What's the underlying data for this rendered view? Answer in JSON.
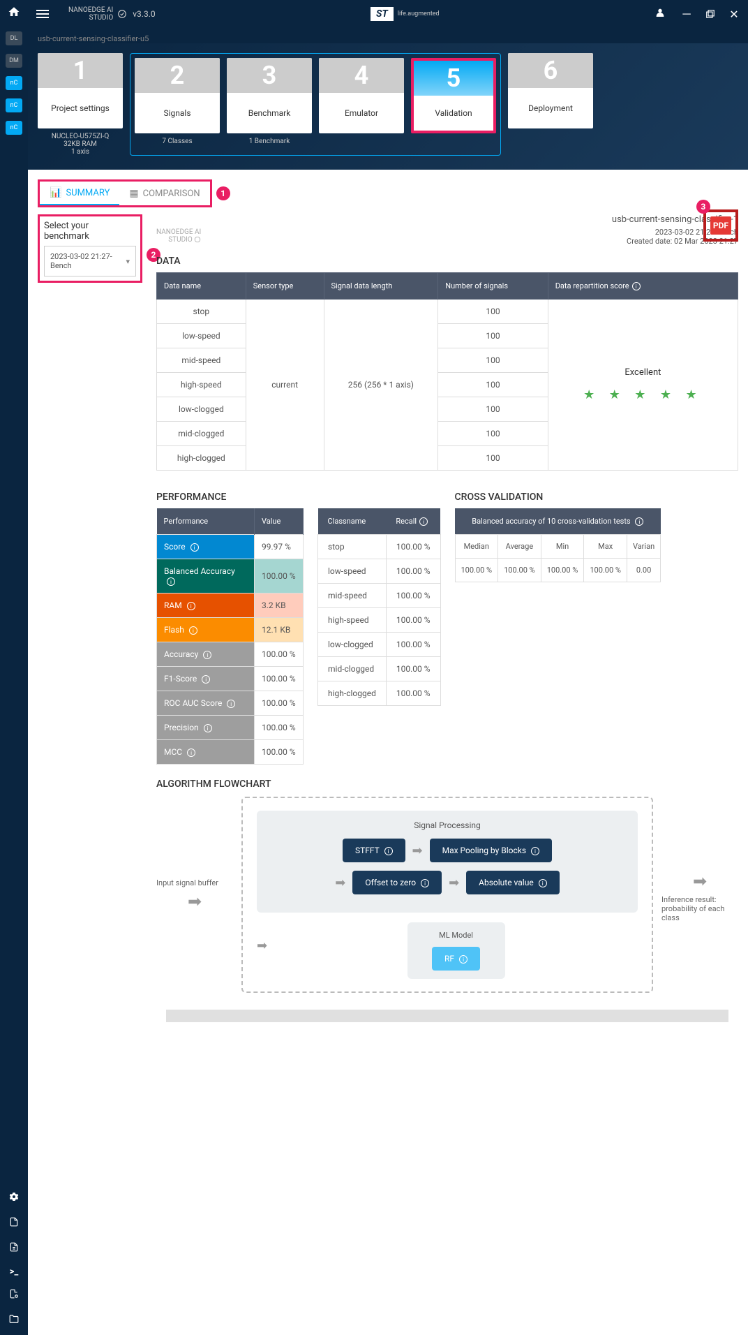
{
  "app": {
    "title_line1": "NANOEDGE AI",
    "title_line2": "STUDIO",
    "version": "v3.3.0",
    "tagline": "life.augmented",
    "st": "ST"
  },
  "sidebar": {
    "items": [
      "DL",
      "DM",
      "nC",
      "nC",
      "nC"
    ],
    "active_index": 2
  },
  "breadcrumb": "usb-current-sensing-classifier-u5",
  "steps": [
    {
      "num": "1",
      "label": "Project settings",
      "info": "NUCLEO-U575ZI-Q\n32KB RAM\n1 axis"
    },
    {
      "num": "2",
      "label": "Signals",
      "info": "7 Classes"
    },
    {
      "num": "3",
      "label": "Benchmark",
      "info": "1 Benchmark"
    },
    {
      "num": "4",
      "label": "Emulator",
      "info": ""
    },
    {
      "num": "5",
      "label": "Validation",
      "info": ""
    },
    {
      "num": "6",
      "label": "Deployment",
      "info": ""
    }
  ],
  "tabs": {
    "summary": "SUMMARY",
    "comparison": "COMPARISON"
  },
  "markers": {
    "m1": "1",
    "m2": "2",
    "m3": "3"
  },
  "benchmark_select": {
    "label": "Select your benchmark",
    "value": "2023-03-02 21:27-Bench"
  },
  "small_logo": {
    "l1": "NANOEDGE AI",
    "l2": "STUDIO"
  },
  "meta": {
    "title": "usb-current-sensing-classifier-1",
    "bench": "2023-03-02 21:27-Bench",
    "created": "Created date: 02 Mar 2023 21:27"
  },
  "pdf_label": "PDF",
  "sections": {
    "data": "DATA",
    "perf": "PERFORMANCE",
    "cross": "CROSS VALIDATION",
    "flow": "ALGORITHM FLOWCHART"
  },
  "data_table": {
    "headers": [
      "Data name",
      "Sensor type",
      "Signal data length",
      "Number of signals",
      "Data repartition score"
    ],
    "names": [
      "stop",
      "low-speed",
      "mid-speed",
      "high-speed",
      "low-clogged",
      "mid-clogged",
      "high-clogged"
    ],
    "sensor": "current",
    "length": "256 (256 * 1 axis)",
    "signals": [
      "100",
      "100",
      "100",
      "100",
      "100",
      "100",
      "100"
    ],
    "rating_label": "Excellent",
    "stars": "★ ★ ★ ★ ★"
  },
  "perf_table": {
    "h1": "Performance",
    "h2": "Value",
    "rows": [
      {
        "label": "Score",
        "value": "99.97 %",
        "cls": "score",
        "vcls": ""
      },
      {
        "label": "Balanced Accuracy",
        "value": "100.00 %",
        "cls": "balacc",
        "vcls": "balacc"
      },
      {
        "label": "RAM",
        "value": "3.2 KB",
        "cls": "ram",
        "vcls": "ram"
      },
      {
        "label": "Flash",
        "value": "12.1 KB",
        "cls": "flash",
        "vcls": "flash"
      },
      {
        "label": "Accuracy",
        "value": "100.00 %",
        "cls": "gray",
        "vcls": ""
      },
      {
        "label": "F1-Score",
        "value": "100.00 %",
        "cls": "gray",
        "vcls": ""
      },
      {
        "label": "ROC AUC Score",
        "value": "100.00 %",
        "cls": "gray",
        "vcls": ""
      },
      {
        "label": "Precision",
        "value": "100.00 %",
        "cls": "gray",
        "vcls": ""
      },
      {
        "label": "MCC",
        "value": "100.00 %",
        "cls": "gray",
        "vcls": ""
      }
    ]
  },
  "recall_table": {
    "h1": "Classname",
    "h2": "Recall",
    "rows": [
      {
        "name": "stop",
        "recall": "100.00 %"
      },
      {
        "name": "low-speed",
        "recall": "100.00 %"
      },
      {
        "name": "mid-speed",
        "recall": "100.00 %"
      },
      {
        "name": "high-speed",
        "recall": "100.00 %"
      },
      {
        "name": "low-clogged",
        "recall": "100.00 %"
      },
      {
        "name": "mid-clogged",
        "recall": "100.00 %"
      },
      {
        "name": "high-clogged",
        "recall": "100.00 %"
      }
    ]
  },
  "cross_table": {
    "header": "Balanced accuracy of 10 cross-validation tests",
    "cols": [
      "Median",
      "Average",
      "Min",
      "Max",
      "Varian"
    ],
    "vals": [
      "100.00 %",
      "100.00 %",
      "100.00 %",
      "100.00 %",
      "0.00"
    ]
  },
  "flowchart": {
    "input": "Input signal buffer",
    "output": "Inference result: probability of each class",
    "proc_title": "Signal Processing",
    "chips": {
      "stfft": "STFFT",
      "maxpool": "Max Pooling by Blocks",
      "offset": "Offset to zero",
      "abs": "Absolute value"
    },
    "ml_title": "ML Model",
    "rf": "RF"
  }
}
